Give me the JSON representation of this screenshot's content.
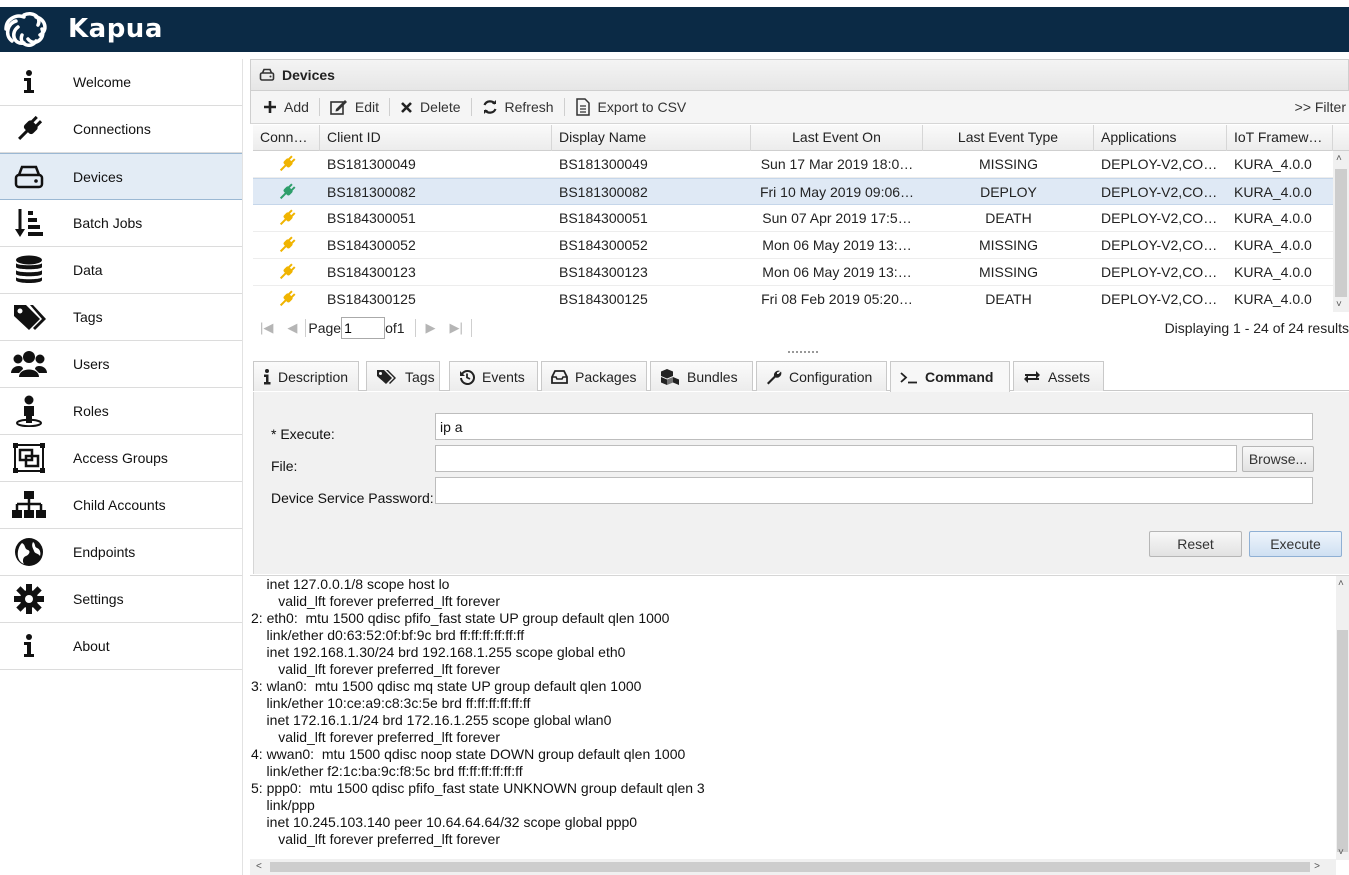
{
  "app": {
    "name": "Kapua"
  },
  "sidebar": {
    "items": [
      {
        "label": "Welcome",
        "icon": "info-icon"
      },
      {
        "label": "Connections",
        "icon": "plug-icon"
      },
      {
        "label": "Devices",
        "icon": "hdd-icon",
        "active": true
      },
      {
        "label": "Batch Jobs",
        "icon": "sort-list-icon"
      },
      {
        "label": "Data",
        "icon": "database-icon"
      },
      {
        "label": "Tags",
        "icon": "tags-icon"
      },
      {
        "label": "Users",
        "icon": "users-icon"
      },
      {
        "label": "Roles",
        "icon": "user-role-icon"
      },
      {
        "label": "Access Groups",
        "icon": "object-group-icon"
      },
      {
        "label": "Child Accounts",
        "icon": "sitemap-icon"
      },
      {
        "label": "Endpoints",
        "icon": "globe-icon"
      },
      {
        "label": "Settings",
        "icon": "gear-icon"
      },
      {
        "label": "About",
        "icon": "info-icon"
      }
    ]
  },
  "panel": {
    "title": "Devices"
  },
  "toolbar": {
    "add": "Add",
    "edit": "Edit",
    "delete": "Delete",
    "refresh": "Refresh",
    "export": "Export to CSV",
    "filter": ">> Filter"
  },
  "grid": {
    "columns": [
      "Conn…",
      "Client ID",
      "Display Name",
      "Last Event On",
      "Last Event Type",
      "Applications",
      "IoT Framew…"
    ],
    "rows": [
      {
        "status": "disconnected",
        "client_id": "BS181300049",
        "display_name": "BS181300049",
        "last_event_on": "Sun 17 Mar 2019 18:0…",
        "last_event_type": "MISSING",
        "applications": "DEPLOY-V2,CO…",
        "framework": "KURA_4.0.0"
      },
      {
        "status": "connected",
        "client_id": "BS181300082",
        "display_name": "BS181300082",
        "last_event_on": "Fri 10 May 2019 09:06…",
        "last_event_type": "DEPLOY",
        "applications": "DEPLOY-V2,CO…",
        "framework": "KURA_4.0.0",
        "selected": true
      },
      {
        "status": "disconnected",
        "client_id": "BS184300051",
        "display_name": "BS184300051",
        "last_event_on": "Sun 07 Apr 2019 17:5…",
        "last_event_type": "DEATH",
        "applications": "DEPLOY-V2,CO…",
        "framework": "KURA_4.0.0"
      },
      {
        "status": "disconnected",
        "client_id": "BS184300052",
        "display_name": "BS184300052",
        "last_event_on": "Mon 06 May 2019 13:…",
        "last_event_type": "MISSING",
        "applications": "DEPLOY-V2,CO…",
        "framework": "KURA_4.0.0"
      },
      {
        "status": "disconnected",
        "client_id": "BS184300123",
        "display_name": "BS184300123",
        "last_event_on": "Mon 06 May 2019 13:…",
        "last_event_type": "MISSING",
        "applications": "DEPLOY-V2,CO…",
        "framework": "KURA_4.0.0"
      },
      {
        "status": "disconnected",
        "client_id": "BS184300125",
        "display_name": "BS184300125",
        "last_event_on": "Fri 08 Feb 2019 05:20…",
        "last_event_type": "DEATH",
        "applications": "DEPLOY-V2,CO…",
        "framework": "KURA_4.0.0"
      }
    ]
  },
  "pager": {
    "page_label": "Page",
    "page_value": "1",
    "of_label": "of1",
    "display": "Displaying 1 - 24 of 24 results"
  },
  "tabs": [
    {
      "label": "Description",
      "icon": "info-icon"
    },
    {
      "label": "Tags",
      "icon": "tags-icon"
    },
    {
      "label": "Events",
      "icon": "history-icon"
    },
    {
      "label": "Packages",
      "icon": "inbox-icon"
    },
    {
      "label": "Bundles",
      "icon": "cubes-icon"
    },
    {
      "label": "Configuration",
      "icon": "wrench-icon"
    },
    {
      "label": "Command",
      "icon": "terminal-icon",
      "active": true
    },
    {
      "label": "Assets",
      "icon": "exchange-icon"
    }
  ],
  "command": {
    "execute_label": "* Execute:",
    "execute_value": "ip a",
    "file_label": "File:",
    "file_value": "",
    "browse": "Browse...",
    "password_label": "Device Service Password:",
    "password_value": "",
    "reset": "Reset",
    "execute_button": "Execute"
  },
  "output": {
    "lines": [
      "    inet 127.0.0.1/8 scope host lo",
      "       valid_lft forever preferred_lft forever",
      "2: eth0:  mtu 1500 qdisc pfifo_fast state UP group default qlen 1000",
      "    link/ether d0:63:52:0f:bf:9c brd ff:ff:ff:ff:ff:ff",
      "    inet 192.168.1.30/24 brd 192.168.1.255 scope global eth0",
      "       valid_lft forever preferred_lft forever",
      "3: wlan0:  mtu 1500 qdisc mq state UP group default qlen 1000",
      "    link/ether 10:ce:a9:c8:3c:5e brd ff:ff:ff:ff:ff:ff",
      "    inet 172.16.1.1/24 brd 172.16.1.255 scope global wlan0",
      "       valid_lft forever preferred_lft forever",
      "4: wwan0:  mtu 1500 qdisc noop state DOWN group default qlen 1000",
      "    link/ether f2:1c:ba:9c:f8:5c brd ff:ff:ff:ff:ff:ff",
      "5: ppp0:  mtu 1500 qdisc pfifo_fast state UNKNOWN group default qlen 3",
      "    link/ppp",
      "    inet 10.245.103.140 peer 10.64.64.64/32 scope global ppp0",
      "       valid_lft forever preferred_lft forever"
    ]
  },
  "colors": {
    "header_bg": "#0b2a45",
    "connected": "#2e9e6b",
    "disconnected": "#f0b400",
    "selected_row": "#dfe9f5"
  }
}
